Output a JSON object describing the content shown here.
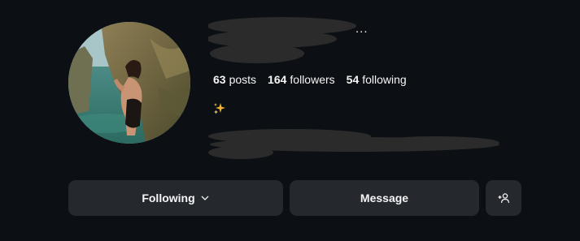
{
  "profile": {
    "avatar_icon": "profile-photo",
    "more_options_glyph": "..."
  },
  "stats": {
    "posts_count": "63",
    "posts_label": "posts",
    "followers_count": "164",
    "followers_label": "followers",
    "following_count": "54",
    "following_label": "following"
  },
  "bio": {
    "emoji_icon": "sparkles-icon"
  },
  "actions": {
    "following_label": "Following",
    "message_label": "Message",
    "add_user_icon": "add-person-icon"
  },
  "colors": {
    "background": "#0c1014",
    "button": "#25292e",
    "text": "#f5f5f5",
    "sparkle": "#f2b233"
  }
}
